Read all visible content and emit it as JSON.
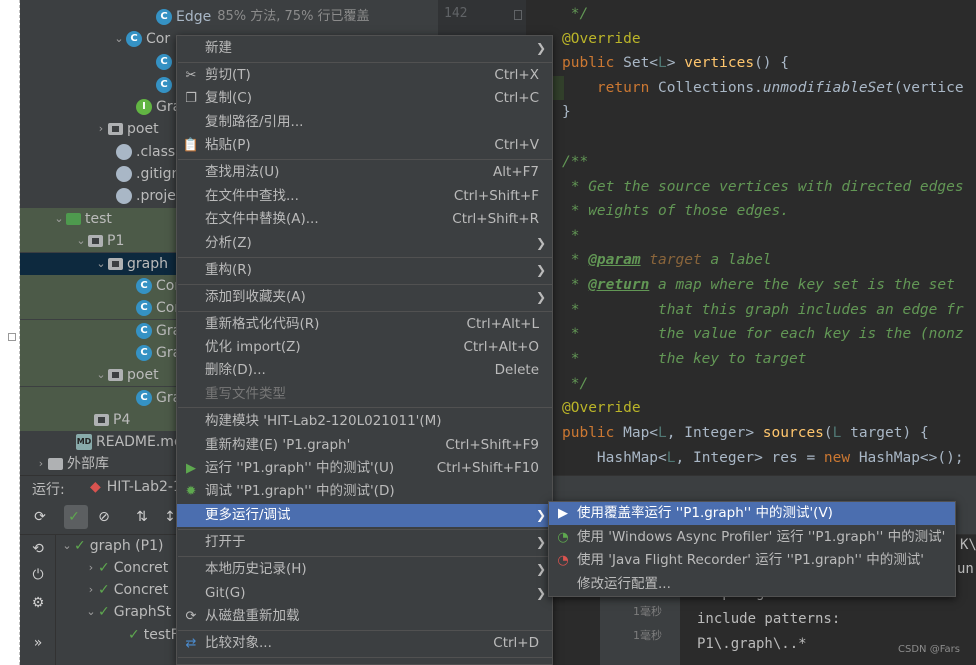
{
  "tree": {
    "edge_name": "Edge",
    "edge_coverage": "85% 方法, 75% 行已覆盖",
    "items": [
      "Cor",
      "Gra",
      "poet",
      ".classp",
      ".gitign",
      ".projec",
      "test",
      "P1",
      "graph",
      "Cor",
      "Cor",
      "Gra",
      "Gra",
      "poet",
      "Gra",
      "P4",
      "README.md",
      "外部库"
    ]
  },
  "editor": {
    "line_number": "142",
    "lines": {
      "l1": " */",
      "l2": "@Override",
      "l3a": "public ",
      "l3b": "Set<",
      "l3c": "L",
      "l3d": "> ",
      "l3e": "vertices",
      "l3f": "() {",
      "l4a": "    return ",
      "l4b": "Collections.",
      "l4c": "unmodifiableSet",
      "l4d": "(vertice",
      "l5": "}",
      "l7": "/**",
      "l8": " * Get the source vertices with directed edges",
      "l9": " * weights of those edges.",
      "l10": " *",
      "l11a": " * ",
      "l11b": "@param",
      "l11c": " target",
      "l11d": " a label",
      "l12a": " * ",
      "l12b": "@return",
      "l12c": " a map where the key set is the set",
      "l13": " *         that this graph includes an edge fr",
      "l14": " *         the value for each key is the (nonz",
      "l15": " *         the key to target",
      "l16": " */",
      "l17": "@Override",
      "l18a": "public ",
      "l18b": "Map<",
      "l18c": "L",
      "l18d": ", Integer> ",
      "l18e": "sources",
      "l18f": "(",
      "l18g": "L",
      "l18h": " target) {",
      "l19a": "    HashMap<",
      "l19b": "L",
      "l19c": ", Integer> res = ",
      "l19d": "new ",
      "l19e": "HashMap<>();"
    }
  },
  "run": {
    "label": "运行:",
    "tab": "HIT-Lab2-1",
    "tree": [
      "graph (P1)",
      "Concret",
      "Concret",
      "GraphSt",
      "testF"
    ],
    "times": [
      "1毫秒",
      "1毫秒"
    ],
    "console": [
      "K\\",
      "un",
      "sampling ...",
      "include patterns:",
      "P1\\.graph\\..*"
    ]
  },
  "context_menu": {
    "items": [
      {
        "label": "新建",
        "shortcut": "",
        "submenu": true
      },
      {
        "label": "剪切(T)",
        "shortcut": "Ctrl+X"
      },
      {
        "label": "复制(C)",
        "shortcut": "Ctrl+C"
      },
      {
        "label": "复制路径/引用...",
        "shortcut": ""
      },
      {
        "label": "粘贴(P)",
        "shortcut": "Ctrl+V"
      },
      {
        "label": "查找用法(U)",
        "shortcut": "Alt+F7"
      },
      {
        "label": "在文件中查找...",
        "shortcut": "Ctrl+Shift+F"
      },
      {
        "label": "在文件中替换(A)...",
        "shortcut": "Ctrl+Shift+R"
      },
      {
        "label": "分析(Z)",
        "shortcut": "",
        "submenu": true
      },
      {
        "label": "重构(R)",
        "shortcut": "",
        "submenu": true
      },
      {
        "label": "添加到收藏夹(A)",
        "shortcut": "",
        "submenu": true
      },
      {
        "label": "重新格式化代码(R)",
        "shortcut": "Ctrl+Alt+L"
      },
      {
        "label": "优化 import(Z)",
        "shortcut": "Ctrl+Alt+O"
      },
      {
        "label": "删除(D)...",
        "shortcut": "Delete"
      },
      {
        "label": "重写文件类型",
        "shortcut": ""
      },
      {
        "label": "构建模块 'HIT-Lab2-120L021011'(M)",
        "shortcut": ""
      },
      {
        "label": "重新构建(E) 'P1.graph'",
        "shortcut": "Ctrl+Shift+F9"
      },
      {
        "label": "运行 ''P1.graph'' 中的测试'(U)",
        "shortcut": "Ctrl+Shift+F10"
      },
      {
        "label": "调试 ''P1.graph'' 中的测试'(D)",
        "shortcut": ""
      },
      {
        "label": "更多运行/调试",
        "shortcut": "",
        "submenu": true
      },
      {
        "label": "打开于",
        "shortcut": "",
        "submenu": true
      },
      {
        "label": "本地历史记录(H)",
        "shortcut": "",
        "submenu": true
      },
      {
        "label": "Git(G)",
        "shortcut": "",
        "submenu": true
      },
      {
        "label": "从磁盘重新加载",
        "shortcut": ""
      },
      {
        "label": "比较对象...",
        "shortcut": "Ctrl+D"
      }
    ]
  },
  "submenu": {
    "items": [
      {
        "label": "使用覆盖率运行 ''P1.graph'' 中的测试'(V)"
      },
      {
        "label": "使用 'Windows Async Profiler' 运行 ''P1.graph'' 中的测试'"
      },
      {
        "label": "使用 'Java Flight Recorder' 运行 ''P1.graph'' 中的测试'"
      },
      {
        "label": "修改运行配置..."
      }
    ]
  },
  "watermark": "CSDN @Fars"
}
